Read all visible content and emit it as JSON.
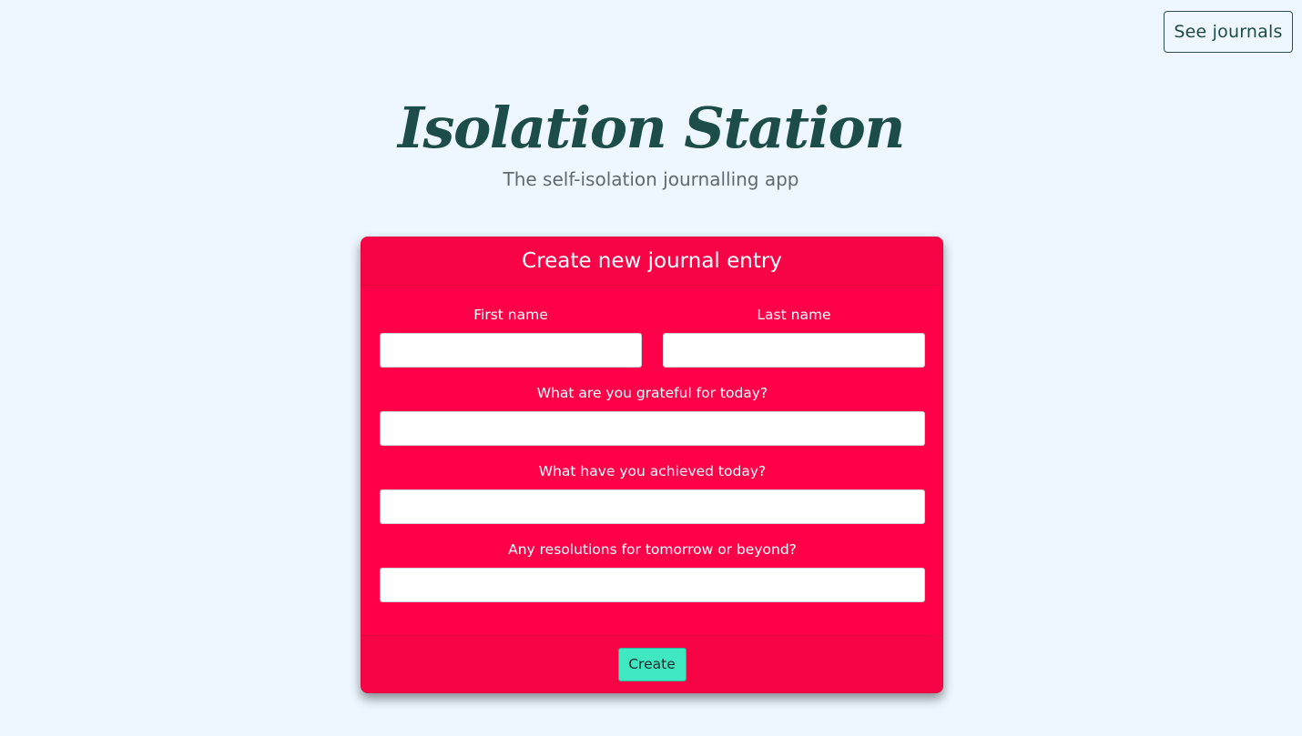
{
  "nav": {
    "see_journals_label": "See journals"
  },
  "header": {
    "title": "Isolation Station",
    "subtitle": "The self-isolation journalling app"
  },
  "form": {
    "title": "Create new journal entry",
    "first_name": {
      "label": "First name",
      "value": "",
      "placeholder": ""
    },
    "last_name": {
      "label": "Last name",
      "value": "",
      "placeholder": ""
    },
    "grateful": {
      "label": "What are you grateful for today?",
      "value": "",
      "placeholder": ""
    },
    "achieved": {
      "label": "What have you achieved today?",
      "value": "",
      "placeholder": ""
    },
    "resolutions": {
      "label": "Any resolutions for tomorrow or beyond?",
      "value": "",
      "placeholder": ""
    },
    "submit_label": "Create"
  },
  "colors": {
    "background": "#eef7ff",
    "card": "#ff0049",
    "card_header": "#f70447",
    "title_text": "#1d4d4b",
    "create_button": "#40e8c1"
  }
}
